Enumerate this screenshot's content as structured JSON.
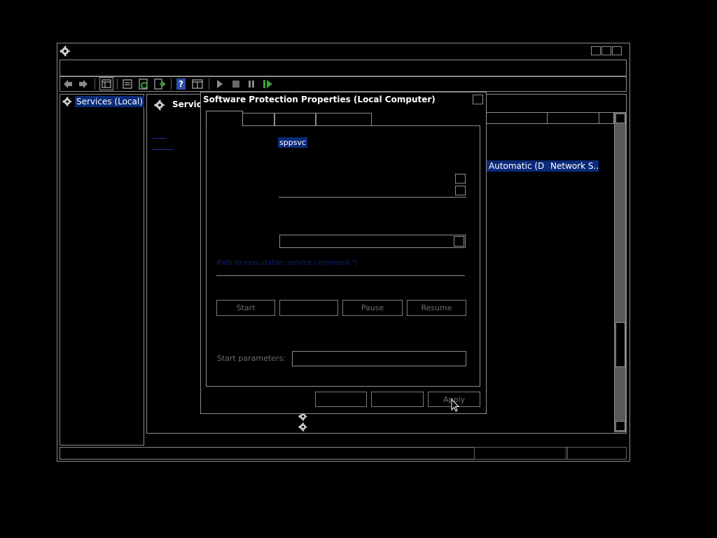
{
  "window": {
    "title_icon": "services-gear-icon"
  },
  "toolbar": {
    "icons": [
      "back-arrow-icon",
      "forward-arrow-icon",
      "console-tree-icon",
      "properties-icon",
      "refresh-icon",
      "export-list-icon",
      "help-icon",
      "show-hide-icon",
      "start-service-icon",
      "stop-service-icon",
      "pause-service-icon",
      "restart-service-icon"
    ]
  },
  "tree": {
    "root_label": "Services (Local)"
  },
  "main": {
    "header_label": "Service",
    "row_startup": "Automatic (D...",
    "row_logon": "Network S..."
  },
  "dialog": {
    "title": "Software Protection Properties (Local Computer)",
    "service_name_value": "sppsvc",
    "path_link": "Path to executable: service command \"sppsvc\"",
    "start_label": "Start",
    "pause_label": "Pause",
    "resume_label": "Resume",
    "start_params_label": "Start parameters:",
    "apply_label": "Apply"
  },
  "colors": {
    "selection": "#0a2a7a",
    "border": "#8c8c8c",
    "background": "#000000"
  }
}
